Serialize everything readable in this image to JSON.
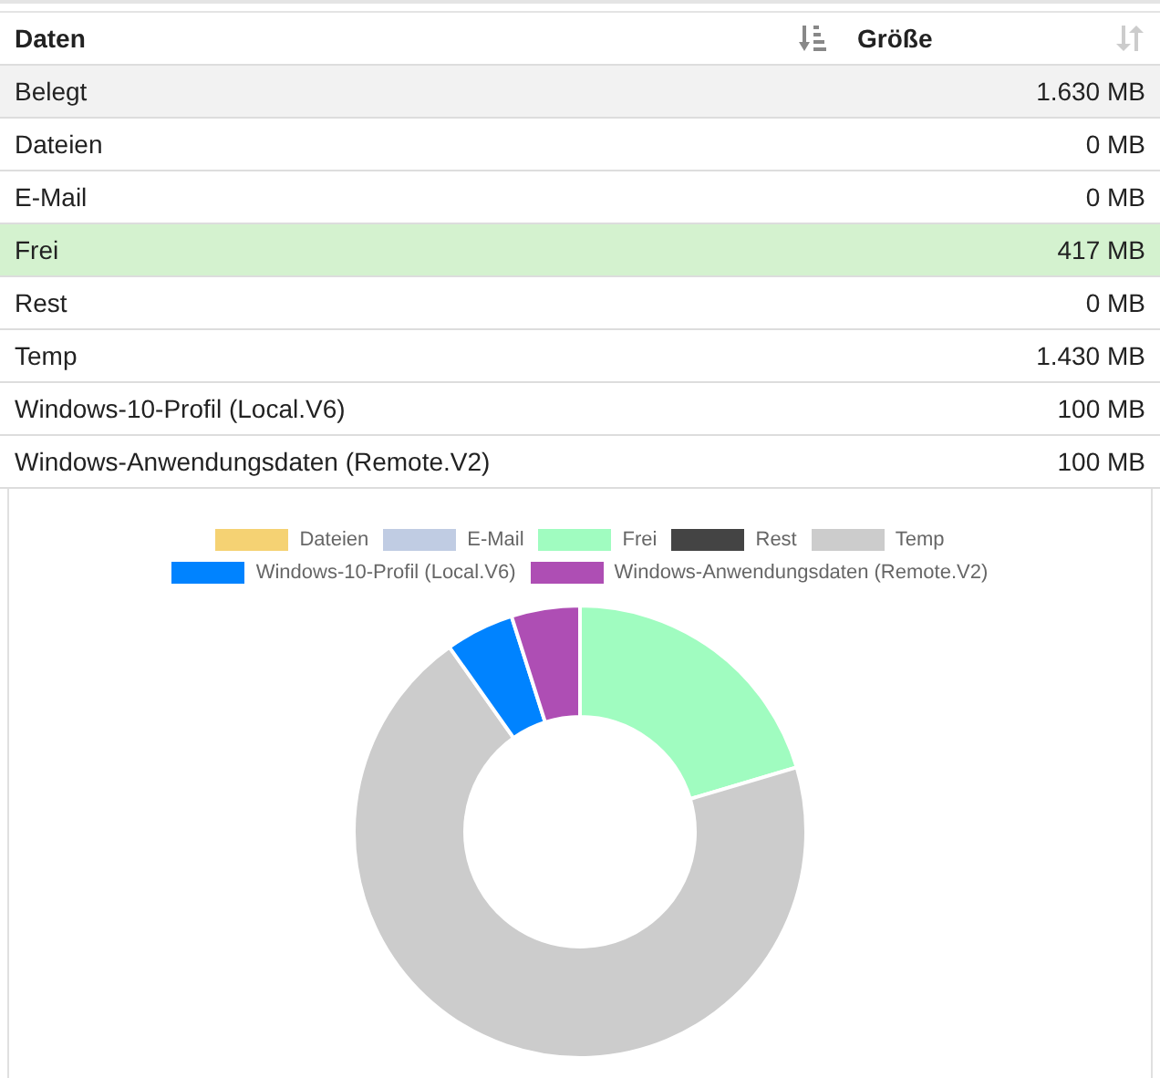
{
  "table": {
    "columns": [
      {
        "label": "Daten",
        "sorted": true
      },
      {
        "label": "Größe",
        "sorted": false
      }
    ],
    "rows": [
      {
        "name": "Belegt",
        "size": "1.630 MB",
        "kind": "total"
      },
      {
        "name": "Dateien",
        "size": "0 MB",
        "kind": "normal"
      },
      {
        "name": "E-Mail",
        "size": "0 MB",
        "kind": "normal"
      },
      {
        "name": "Frei",
        "size": "417 MB",
        "kind": "free"
      },
      {
        "name": "Rest",
        "size": "0 MB",
        "kind": "normal"
      },
      {
        "name": "Temp",
        "size": "1.430 MB",
        "kind": "normal"
      },
      {
        "name": "Windows-10-Profil (Local.V6)",
        "size": "100 MB",
        "kind": "normal"
      },
      {
        "name": "Windows-Anwendungsdaten (Remote.V2)",
        "size": "100 MB",
        "kind": "normal"
      }
    ]
  },
  "chart": {
    "chart_data": {
      "type": "donut",
      "categories": [
        "Dateien",
        "E-Mail",
        "Frei",
        "Rest",
        "Temp",
        "Windows-10-Profil (Local.V6)",
        "Windows-Anwendungsdaten (Remote.V2)"
      ],
      "legend": "top",
      "series": [
        {
          "values": [
            0,
            0,
            20.4,
            0,
            69.8,
            4.9,
            4.9
          ],
          "colors": [
            "#f5d273",
            "#c0cce3",
            "#a0fcc0",
            "#444444",
            "#cccccc",
            "#0083ff",
            "#ae4eb4"
          ]
        }
      ]
    }
  }
}
